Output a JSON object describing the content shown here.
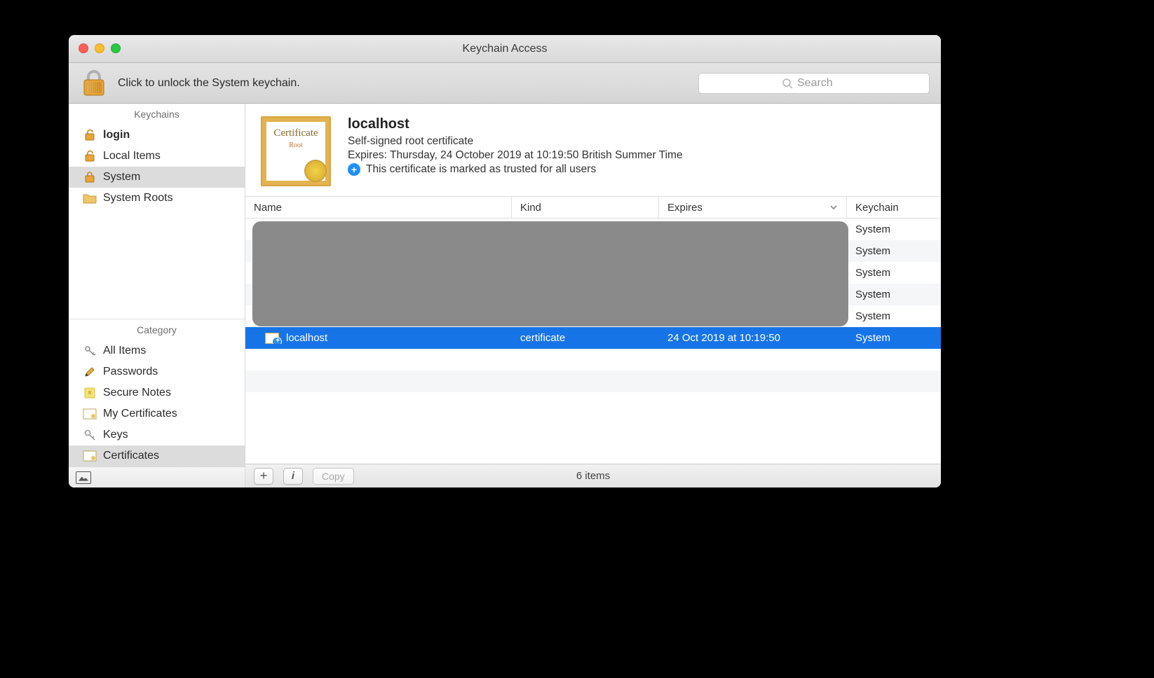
{
  "window": {
    "title": "Keychain Access"
  },
  "toolbar": {
    "hint": "Click to unlock the System keychain.",
    "search_placeholder": "Search"
  },
  "sidebar": {
    "header_keychains": "Keychains",
    "header_category": "Category",
    "keychains": [
      {
        "label": "login",
        "bold": true,
        "selected": false
      },
      {
        "label": "Local Items",
        "bold": false,
        "selected": false
      },
      {
        "label": "System",
        "bold": false,
        "selected": true
      },
      {
        "label": "System Roots",
        "bold": false,
        "selected": false
      }
    ],
    "categories": [
      {
        "label": "All Items",
        "selected": false
      },
      {
        "label": "Passwords",
        "selected": false
      },
      {
        "label": "Secure Notes",
        "selected": false
      },
      {
        "label": "My Certificates",
        "selected": false
      },
      {
        "label": "Keys",
        "selected": false
      },
      {
        "label": "Certificates",
        "selected": true
      }
    ]
  },
  "detail": {
    "thumb_label_line1": "Certificate",
    "thumb_label_line2": "Root",
    "name": "localhost",
    "type": "Self-signed root certificate",
    "expires": "Expires: Thursday, 24 October 2019 at 10:19:50 British Summer Time",
    "trust": "This certificate is marked as trusted for all users",
    "trust_badge": "+"
  },
  "table": {
    "columns": {
      "name": "Name",
      "kind": "Kind",
      "expires": "Expires",
      "keychain": "Keychain"
    },
    "rows": [
      {
        "name": "",
        "kind": "",
        "expires": "",
        "keychain": "System",
        "selected": false,
        "hidden": true
      },
      {
        "name": "",
        "kind": "",
        "expires": "",
        "keychain": "System",
        "selected": false,
        "hidden": true
      },
      {
        "name": "",
        "kind": "",
        "expires": "",
        "keychain": "System",
        "selected": false,
        "hidden": true
      },
      {
        "name": "",
        "kind": "",
        "expires": "",
        "keychain": "System",
        "selected": false,
        "hidden": true
      },
      {
        "name": "",
        "kind": "",
        "expires": "",
        "keychain": "System",
        "selected": false,
        "hidden": true
      },
      {
        "name": "localhost",
        "kind": "certificate",
        "expires": "24 Oct 2019 at 10:19:50",
        "keychain": "System",
        "selected": true,
        "hidden": false
      }
    ]
  },
  "footer": {
    "add": "+",
    "info": "i",
    "copy": "Copy",
    "count": "6 items"
  }
}
